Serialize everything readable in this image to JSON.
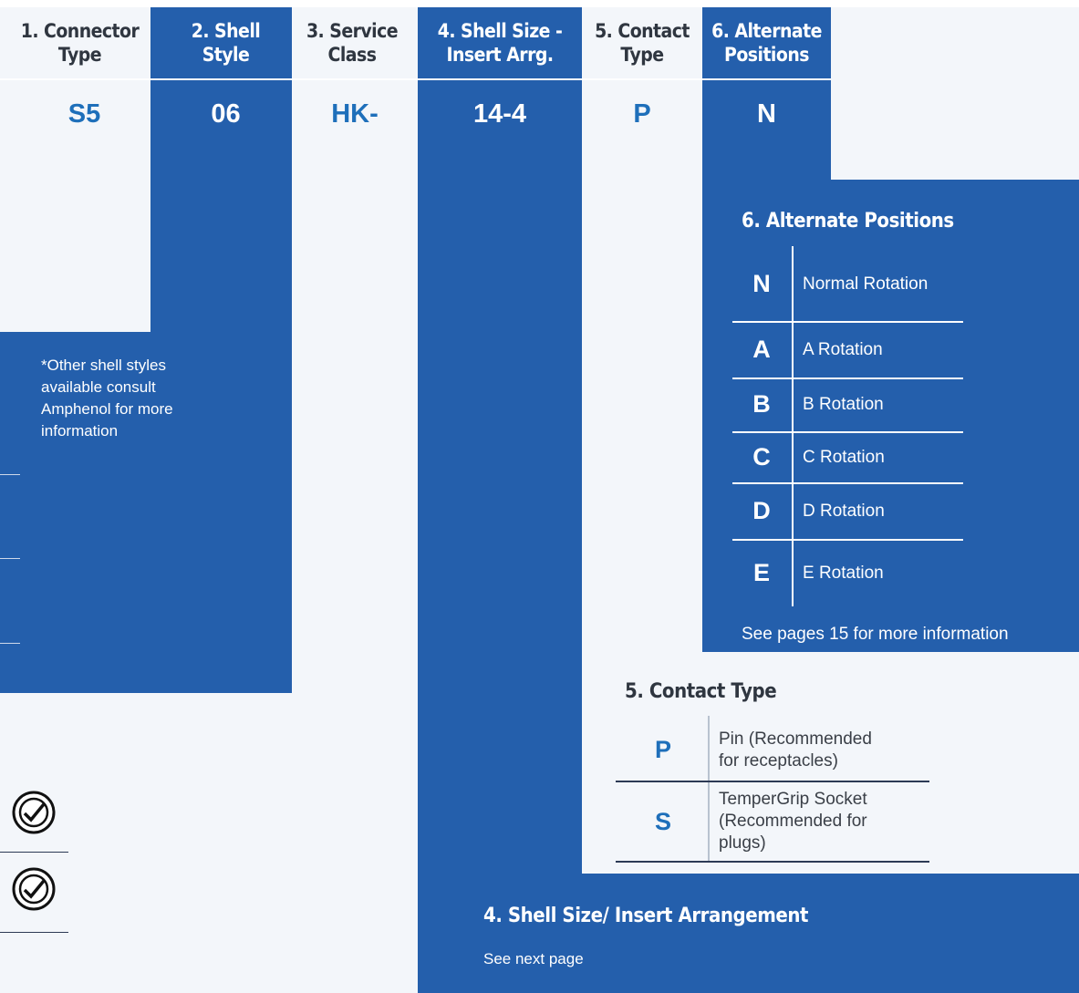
{
  "columns": [
    {
      "header": "1. Connector Type",
      "header_lines": [
        "1. Connector",
        "Type"
      ],
      "code": "S5"
    },
    {
      "header": "2. Shell Style",
      "header_lines": [
        "2. Shell",
        "Style"
      ],
      "code": "06"
    },
    {
      "header": "3. Service Class",
      "header_lines": [
        "3. Service",
        "Class"
      ],
      "code": "HK-"
    },
    {
      "header": "4. Shell Size - Insert Arrg.",
      "header_lines": [
        "4. Shell Size -",
        "Insert Arrg."
      ],
      "code": "14-4"
    },
    {
      "header": "5. Contact Type",
      "header_lines": [
        "5. Contact",
        "Type"
      ],
      "code": "P"
    },
    {
      "header": "6. Alternate Positions",
      "header_lines": [
        "6. Alternate",
        "Positions"
      ],
      "code": "N"
    }
  ],
  "shell_style_note": "*Other shell styles available consult Amphenol for more information",
  "alternate_positions": {
    "title": "6. Alternate Positions",
    "rows": [
      {
        "code": "N",
        "label": "Normal Rotation"
      },
      {
        "code": "A",
        "label": "A Rotation"
      },
      {
        "code": "B",
        "label": "B Rotation"
      },
      {
        "code": "C",
        "label": "C Rotation"
      },
      {
        "code": "D",
        "label": "D Rotation"
      },
      {
        "code": "E",
        "label": "E Rotation"
      }
    ],
    "footnote": "See pages 15 for more information"
  },
  "contact_type": {
    "title": "5. Contact Type",
    "rows": [
      {
        "code": "P",
        "label_lines": [
          "Pin (Recommended",
          "for receptacles)"
        ]
      },
      {
        "code": "S",
        "label_lines": [
          "TemperGrip Socket",
          "(Recommended for",
          "plugs)"
        ]
      }
    ]
  },
  "shell_size": {
    "title": "4. Shell Size/ Insert Arrangement",
    "note": "See next page"
  },
  "colors": {
    "blue": "#245fac",
    "light": "#f3f6fa",
    "code_blue": "#1e6fba",
    "dark_text": "#2f3640"
  },
  "icons": [
    "rohs-icon",
    "rohs-icon"
  ]
}
